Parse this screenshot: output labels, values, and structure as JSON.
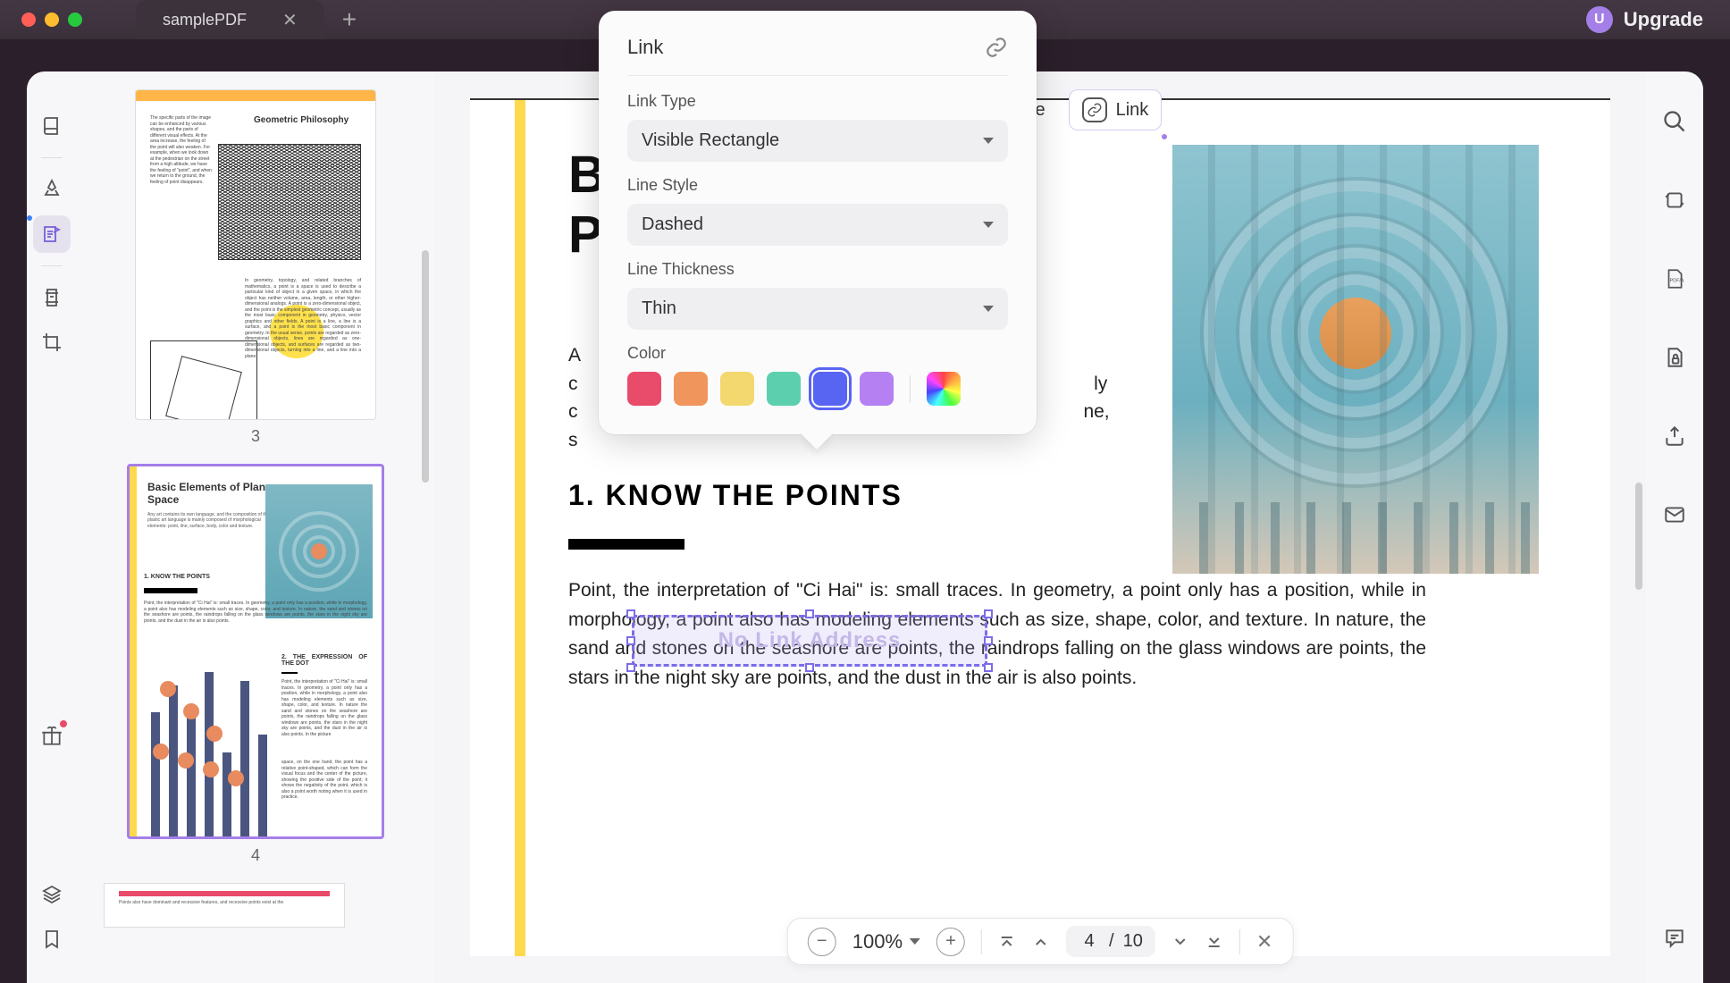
{
  "app": {
    "tab_name": "samplePDF",
    "upgrade_label": "Upgrade",
    "upgrade_badge": "U"
  },
  "left_tools": {
    "book": "book-icon",
    "highlighter": "highlighter-icon",
    "edit": "edit-icon",
    "forms": "forms-icon",
    "crop": "crop-icon",
    "gift": "gift-icon",
    "layers": "layers-icon",
    "bookmark": "bookmark-icon"
  },
  "thumbnails": {
    "page3": {
      "num": "3",
      "heading": "Geometric Philosophy",
      "left_text": "The specific parts of the image can be enhanced by various shapes, and the parts of different visual effects. At the area increase, the feeling of the point will also weaken. For example, when we look down at the pedestrian on the street from a high altitude, we have the feeling of \"point\", and when we return to the ground, the feeling of point disappears.",
      "right_text": "In geometry, topology, and related branches of mathematics, a point is a space is used to describe a particular kind of object in a given space, in which the object has neither volume, area, length, or other higher-dimensional analogs. A point is a zero-dimensional object, and the point is the simplest geometric concept, usually as the most basic component in geometry, physics, vector graphics and other fields. A point is a line, a line is a surface, and a point is the most basic component in geometry. In the usual sense, points are regarded as zero-dimensional objects, lines are regarded as one-dimensional objects, and surfaces are regarded as two-dimensional objects, turning into a line, and a line into a plane."
    },
    "page4": {
      "num": "4",
      "heading": "Basic Elements of Plane Space",
      "sub": "Any art contains its own language, and the composition of the plastic art language is mainly composed of morphological elements: point, line, surface, body, color and texture.",
      "sec1": "1. KNOW THE POINTS",
      "p1": "Point, the interpretation of \"Ci Hai\" is: small traces. In geometry, a point only has a position, while in morphology, a point also has modeling elements such as size, shape, color, and texture. In nature, the sand and stones on the seashore are points, the raindrops falling on the glass windows are points, the stars in the night sky are points, and the dust in the air is also points.",
      "sec2": "2. THE EXPRESSION OF THE DOT",
      "p2": "Point, the interpretation of \"Ci Hai\" is: small traces. In geometry, a point only has a position, while in morphology, a point also has modeling elements such as size, shape, color, and texture. In nature the sand and stones on the seashore are points, the raindrops falling on the glass windows are points, the stars in the night sky are points, and the dust in the air is also points. In the picture",
      "p3": "space, on the one hand, the point has a relative point-shaped, which can form the visual focus and the center of the picture, showing the positive side of the point; it shows the negativity of the point, which is also a point worth noting when it is used in practice."
    },
    "page5": {
      "txt": "Points also have dominant and recessive features, and recessive points exist at the"
    }
  },
  "document": {
    "title_l1": "B",
    "title_l2": "P",
    "visible_intro_frag1": "A",
    "visible_intro_frag2": "c                                                                                                   ly",
    "visible_intro_frag3": "c                                                                                                 ne,",
    "visible_intro_frag4": "s",
    "section1": "1. KNOW THE POINTS",
    "body2": "Point, the interpretation of \"Ci Hai\" is: small traces. In geometry, a point only has a position, while in morphology, a point also has modeling elements such as size, shape, color, and texture. In nature, the sand and stones on the seashore are points, the raindrops falling on the glass windows are points, the stars in the night sky are points, and the dust in the air is also points."
  },
  "link_annotation": {
    "placeholder": "No Link Address"
  },
  "top_toolbar": {
    "image_label": "Image",
    "link_label": "Link"
  },
  "popup": {
    "title": "Link",
    "link_type_label": "Link Type",
    "link_type_value": "Visible Rectangle",
    "line_style_label": "Line Style",
    "line_style_value": "Dashed",
    "line_thickness_label": "Line Thickness",
    "line_thickness_value": "Thin",
    "color_label": "Color",
    "colors": {
      "red": "#e94b6a",
      "orange": "#f0955c",
      "yellow": "#f2d86e",
      "teal": "#5cd0ae",
      "blue": "#5865f2",
      "purple": "#b580f2"
    },
    "selected_color": "blue"
  },
  "bottom_bar": {
    "zoom": "100%",
    "current_page": "4",
    "page_sep": "/",
    "total_pages": "10"
  }
}
